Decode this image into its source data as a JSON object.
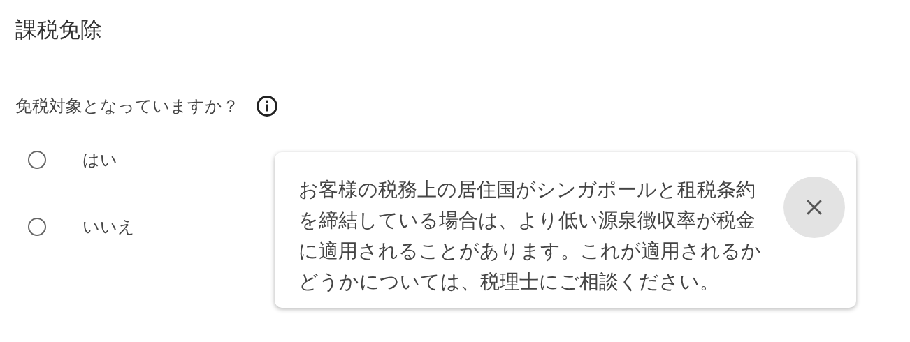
{
  "section_title": "課税免除",
  "question": {
    "label": "免税対象となっていますか？"
  },
  "options": [
    {
      "label": "はい",
      "selected": false
    },
    {
      "label": "いいえ",
      "selected": false
    }
  ],
  "tooltip": {
    "text": "お客様の税務上の居住国がシンガポールと租税条約を締結している場合は、より低い源泉徴収率が税金に適用されることがあります。これが適用されるかどうかについては、税理士にご相談ください。",
    "open": true
  }
}
